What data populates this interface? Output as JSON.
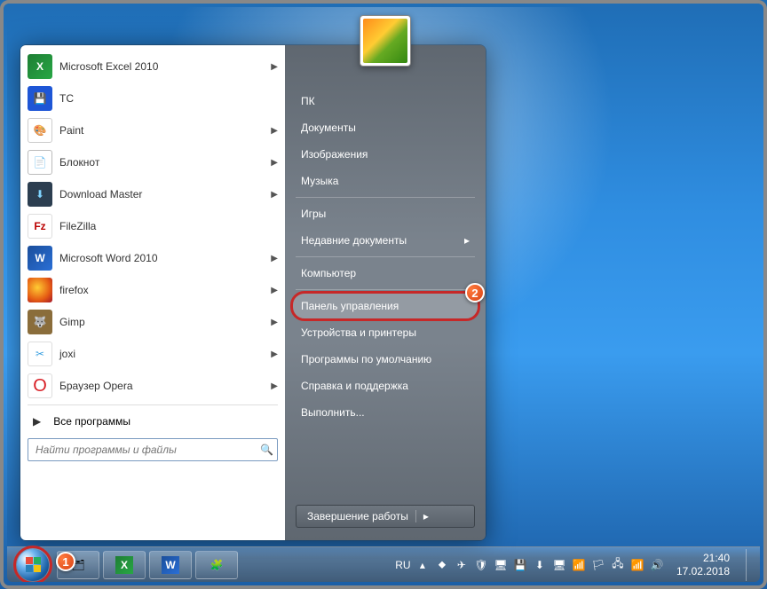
{
  "programs": [
    {
      "label": "Microsoft Excel 2010",
      "icon": "i-excel",
      "glyph": "X",
      "arrow": true
    },
    {
      "label": "TC",
      "icon": "i-tc",
      "glyph": "💾",
      "arrow": false
    },
    {
      "label": "Paint",
      "icon": "i-paint",
      "glyph": "🎨",
      "arrow": true
    },
    {
      "label": "Блокнот",
      "icon": "i-note",
      "glyph": "📄",
      "arrow": true
    },
    {
      "label": "Download Master",
      "icon": "i-dm",
      "glyph": "⬇",
      "arrow": true
    },
    {
      "label": "FileZilla",
      "icon": "i-fz",
      "glyph": "Fz",
      "arrow": false
    },
    {
      "label": "Microsoft Word 2010",
      "icon": "i-word",
      "glyph": "W",
      "arrow": true
    },
    {
      "label": "firefox",
      "icon": "i-ff",
      "glyph": "",
      "arrow": true
    },
    {
      "label": "Gimp",
      "icon": "i-gimp",
      "glyph": "🐺",
      "arrow": true
    },
    {
      "label": "joxi",
      "icon": "i-joxi",
      "glyph": "✂",
      "arrow": true
    },
    {
      "label": "Браузер Opera",
      "icon": "i-opera",
      "glyph": "O",
      "arrow": true
    }
  ],
  "all_programs": "Все программы",
  "search_placeholder": "Найти программы и файлы",
  "right": [
    {
      "label": "ПК",
      "sep": false
    },
    {
      "label": "Документы",
      "sep": false
    },
    {
      "label": "Изображения",
      "sep": false
    },
    {
      "label": "Музыка",
      "sep": false
    },
    {
      "label": "",
      "sep": true
    },
    {
      "label": "Игры",
      "sep": false
    },
    {
      "label": "Недавние документы",
      "sep": false,
      "arrow": true
    },
    {
      "label": "",
      "sep": true
    },
    {
      "label": "Компьютер",
      "sep": false
    },
    {
      "label": "",
      "sep": true
    },
    {
      "label": "Панель управления",
      "sep": false,
      "hl": true
    },
    {
      "label": "Устройства и принтеры",
      "sep": false
    },
    {
      "label": "Программы по умолчанию",
      "sep": false
    },
    {
      "label": "Справка и поддержка",
      "sep": false
    },
    {
      "label": "Выполнить...",
      "sep": false
    }
  ],
  "shutdown": "Завершение работы",
  "lang": "RU",
  "time": "21:40",
  "date": "17.02.2018",
  "callout1": "1",
  "callout2": "2"
}
